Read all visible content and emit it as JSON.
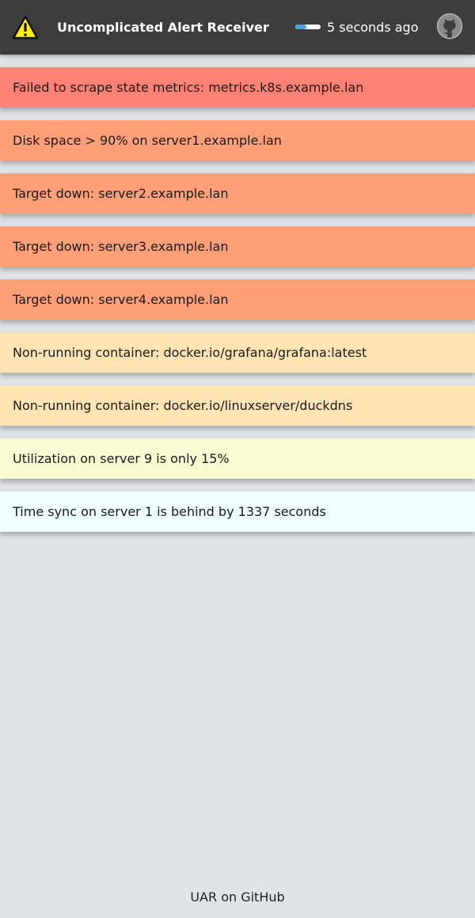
{
  "header": {
    "title": "Uncomplicated Alert Receiver",
    "last_updated": "5 seconds ago",
    "refresh_progress": 0.45,
    "logo_icon": "warning-triangle-icon",
    "github_icon": "github-icon"
  },
  "alerts": [
    {
      "text": "Failed to scrape state metrics: metrics.k8s.example.lan",
      "color": "#fe8173"
    },
    {
      "text": "Disk space > 90% on server1.example.lan",
      "color": "#fe9f77"
    },
    {
      "text": "Target down: server2.example.lan",
      "color": "#fe9f77"
    },
    {
      "text": "Target down: server3.example.lan",
      "color": "#fe9f77"
    },
    {
      "text": "Target down: server4.example.lan",
      "color": "#fe9f77"
    },
    {
      "text": "Non-running container: docker.io/grafana/grafana:latest",
      "color": "#ffe3b3"
    },
    {
      "text": "Non-running container: docker.io/linuxserver/duckdns",
      "color": "#ffe3b3"
    },
    {
      "text": "Utilization on server 9 is only 15%",
      "color": "#fafad2"
    },
    {
      "text": "Time sync on server 1 is behind by 1337 seconds",
      "color": "#effeff"
    }
  ],
  "footer": {
    "link_label": "UAR on GitHub"
  },
  "colors": {
    "header_bg": "#3d3d3d",
    "page_bg": "#dfe3e7",
    "warning_yellow": "#ffef00"
  }
}
